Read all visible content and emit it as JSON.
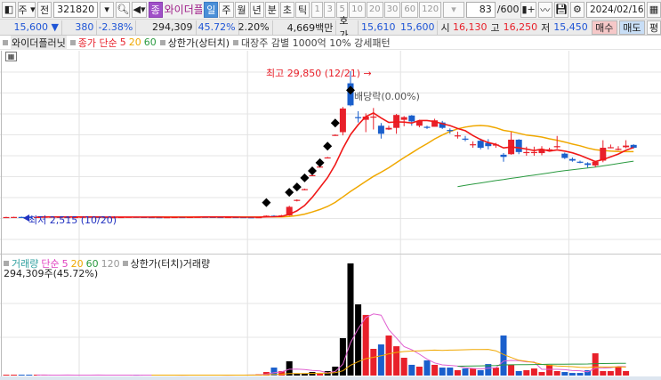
{
  "toolbar": {
    "type": "주",
    "prev": "전",
    "code": "321820",
    "badge": "종",
    "name": "와이더플러",
    "periods": [
      "일",
      "주",
      "월",
      "년",
      "분",
      "초",
      "틱"
    ],
    "active_period": "일",
    "numbers": [
      "1",
      "3",
      "5",
      "10",
      "20",
      "30",
      "60",
      "120"
    ],
    "count": "83",
    "count_total": "/600",
    "date": "2024/02/16"
  },
  "quote": {
    "price": "15,600",
    "arrow": "▼",
    "change": "380",
    "change_pct": "-2.38%",
    "volume": "294,309",
    "vol_ratio": "45.72%",
    "turnover": "2.20%",
    "amount": "4,669백만",
    "hoga_label": "호가",
    "ask": "15,610",
    "bid": "15,600",
    "open_label": "시",
    "open": "16,130",
    "high_label": "고",
    "high": "16,250",
    "low_label": "저",
    "low": "15,450",
    "buy": "매수",
    "sell": "매도",
    "avg": "평"
  },
  "legend": {
    "title": "와이더플러닛",
    "ma_label": "종가 단순",
    "ma": [
      "5",
      "20",
      "60"
    ],
    "limit": "상한가(상터치)",
    "pattern": "대장주 감별 1000억 10% 강세패턴"
  },
  "vol_legend": {
    "title": "거래량",
    "ma_label": "단순",
    "ma": [
      "5",
      "20",
      "60",
      "120"
    ],
    "limit": "상한가(터치)거래량",
    "current": "294,309주(45.72%)"
  },
  "annotations": {
    "high": "최고 29,850 (12/21) →",
    "low": "최저 2,515 (10/20)",
    "ex_div": "배당락(0.00%)"
  },
  "colors": {
    "up": "#e8202a",
    "down": "#1a5fcc",
    "ma5": "#f01818",
    "ma20": "#f0a800",
    "ma60": "#2a9a40",
    "vma5": "#e060d0",
    "limit": "#000000"
  },
  "chart_data": {
    "type": "candlestick",
    "price_range": [
      2515,
      29850
    ],
    "candles": [
      [
        2700,
        2750,
        2650,
        2700
      ],
      [
        2700,
        2760,
        2660,
        2720
      ],
      [
        2720,
        2780,
        2680,
        2700
      ],
      [
        2700,
        2740,
        2650,
        2680
      ],
      [
        2680,
        2750,
        2640,
        2720
      ],
      [
        2720,
        2790,
        2700,
        2760
      ],
      [
        2760,
        2800,
        2700,
        2720
      ],
      [
        2720,
        2760,
        2680,
        2700
      ],
      [
        2700,
        2740,
        2660,
        2690
      ],
      [
        2690,
        2730,
        2650,
        2700
      ],
      [
        2700,
        2760,
        2680,
        2740
      ],
      [
        2740,
        2780,
        2700,
        2720
      ],
      [
        2720,
        2750,
        2680,
        2690
      ],
      [
        2690,
        2720,
        2640,
        2660
      ],
      [
        2660,
        2700,
        2620,
        2680
      ],
      [
        2680,
        2720,
        2640,
        2700
      ],
      [
        2700,
        2760,
        2680,
        2740
      ],
      [
        2740,
        2780,
        2700,
        2710
      ],
      [
        2710,
        2750,
        2660,
        2690
      ],
      [
        2690,
        2730,
        2640,
        2680
      ],
      [
        2680,
        2720,
        2620,
        2650
      ],
      [
        2650,
        2700,
        2600,
        2680
      ],
      [
        2680,
        2720,
        2650,
        2700
      ],
      [
        2700,
        2740,
        2660,
        2690
      ],
      [
        2690,
        2730,
        2650,
        2710
      ],
      [
        2710,
        2760,
        2690,
        2740
      ],
      [
        2740,
        2780,
        2700,
        2720
      ],
      [
        2720,
        2750,
        2680,
        2700
      ],
      [
        2700,
        2730,
        2660,
        2680
      ],
      [
        2680,
        2720,
        2640,
        2700
      ],
      [
        2700,
        2740,
        2670,
        2690
      ],
      [
        2690,
        2720,
        2650,
        2670
      ],
      [
        2670,
        2700,
        2600,
        2640
      ],
      [
        2640,
        2700,
        2515,
        2680
      ],
      [
        2700,
        3000,
        2650,
        2950
      ],
      [
        2950,
        3050,
        2800,
        2850
      ],
      [
        2850,
        3100,
        2800,
        3000
      ],
      [
        3000,
        4800,
        2950,
        4600
      ],
      [
        5700,
        6000,
        5600,
        5900
      ],
      [
        7800,
        8000,
        7700,
        7900
      ],
      [
        10400,
        10600,
        10300,
        10500
      ],
      [
        12000,
        12200,
        11900,
        12100
      ],
      [
        13700,
        13900,
        13600,
        13800
      ],
      [
        17900,
        18100,
        17800,
        18000
      ],
      [
        18500,
        23200,
        17900,
        22900
      ],
      [
        27600,
        29850,
        23300,
        23500
      ],
      [
        21300,
        22400,
        20300,
        21200
      ],
      [
        20800,
        22000,
        18500,
        21400
      ],
      [
        21300,
        23000,
        19000,
        21400
      ],
      [
        19700,
        20200,
        17300,
        18200
      ],
      [
        19000,
        19700,
        18900,
        19300
      ],
      [
        19300,
        21900,
        18200,
        21700
      ],
      [
        20800,
        21500,
        19600,
        21300
      ],
      [
        21600,
        21700,
        19700,
        20500
      ],
      [
        19700,
        20800,
        19400,
        20600
      ],
      [
        19500,
        19700,
        19100,
        19300
      ],
      [
        19500,
        21000,
        19500,
        20700
      ],
      [
        20300,
        20600,
        19100,
        19300
      ],
      [
        18900,
        19200,
        18200,
        18700
      ],
      [
        17800,
        18600,
        17300,
        17900
      ],
      [
        17300,
        17800,
        16800,
        17200
      ],
      [
        16200,
        16800,
        15600,
        16250
      ],
      [
        16900,
        17300,
        15300,
        15600
      ],
      [
        16500,
        17200,
        15300,
        15900
      ],
      [
        16100,
        16500,
        15600,
        16200
      ],
      [
        14300,
        14600,
        13000,
        13900
      ],
      [
        14400,
        18500,
        14300,
        17100
      ],
      [
        17100,
        17200,
        14400,
        14800
      ],
      [
        14750,
        15800,
        14100,
        14800
      ],
      [
        14600,
        15800,
        14100,
        14800
      ],
      [
        14600,
        15900,
        14200,
        15200
      ],
      [
        15200,
        15600,
        15000,
        15300
      ],
      [
        15700,
        17800,
        15400,
        15900
      ],
      [
        14500,
        14700,
        13500,
        13700
      ],
      [
        13500,
        13800,
        13000,
        13200
      ],
      [
        13000,
        13200,
        12700,
        12900
      ],
      [
        12700,
        12900,
        11900,
        12400
      ],
      [
        12300,
        13200,
        12000,
        13000
      ],
      [
        13200,
        17000,
        12900,
        15600
      ],
      [
        15600,
        16200,
        15500,
        15700
      ],
      [
        15300,
        15900,
        15100,
        15400
      ],
      [
        15700,
        17000,
        15500,
        16000
      ],
      [
        16130,
        16250,
        15450,
        15600
      ]
    ],
    "volumes": [
      30000,
      40000,
      20000,
      30000,
      50000,
      20000,
      30000,
      20000,
      40000,
      30000,
      20000,
      30000,
      40000,
      20000,
      30000,
      20000,
      30000,
      20000,
      40000,
      30000,
      20000,
      30000,
      20000,
      30000,
      40000,
      20000,
      30000,
      20000,
      30000,
      20000,
      40000,
      30000,
      60000,
      80000,
      230000,
      520000,
      290000,
      930000,
      120000,
      120000,
      230000,
      120000,
      290000,
      580000,
      2440000,
      7310000,
      4640000,
      3950000,
      1740000,
      2030000,
      2610000,
      1910000,
      1160000,
      700000,
      580000,
      990000,
      700000,
      520000,
      520000,
      350000,
      460000,
      460000,
      350000,
      750000,
      520000,
      2610000,
      700000,
      290000,
      350000,
      460000,
      230000,
      700000,
      290000,
      230000,
      170000,
      170000,
      350000,
      1450000,
      290000,
      290000,
      580000,
      294309
    ],
    "limit_touch": [
      37,
      38,
      39,
      40,
      42,
      43,
      44,
      45,
      46
    ],
    "limit_markers": [
      [
        34,
        5400
      ],
      [
        37,
        7300
      ],
      [
        38,
        8300
      ],
      [
        39,
        10000
      ],
      [
        40,
        11300
      ],
      [
        41,
        12800
      ],
      [
        42,
        15900
      ],
      [
        43,
        20200
      ],
      [
        45,
        26300
      ]
    ],
    "x_months": [
      10,
      32,
      52,
      74
    ]
  }
}
